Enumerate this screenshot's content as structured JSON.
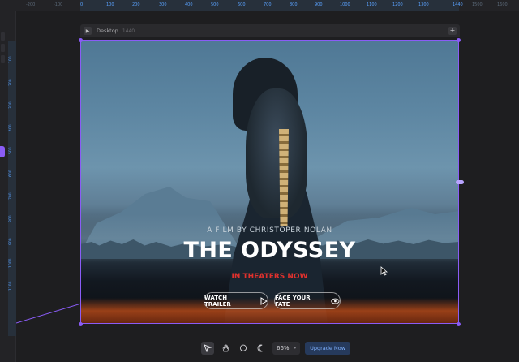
{
  "ruler": {
    "top_ticks": [
      "-200",
      "-100",
      "0",
      "100",
      "200",
      "300",
      "400",
      "500",
      "600",
      "700",
      "800",
      "900",
      "1000",
      "1100",
      "1200",
      "1300",
      "1440",
      "1500",
      "1600"
    ],
    "left_ticks": [
      "0",
      "100",
      "200",
      "300",
      "400",
      "500",
      "600",
      "700",
      "800",
      "900",
      "1000",
      "1100",
      "1200",
      "1300"
    ]
  },
  "frame": {
    "name": "Desktop",
    "width_label": "1440"
  },
  "hero": {
    "subtitle": "A FILM BY CHRISTOPER NOLAN",
    "title": "THE ODYSSEY",
    "release_note": "IN THEATERS NOW",
    "trailer_button": "WATCH TRAILER",
    "fate_button": "FACE YOUR FATE"
  },
  "toolbar": {
    "zoom_value": "66%",
    "upgrade_label": "Upgrade Now",
    "tools": [
      "cursor-tool-icon",
      "hand-tool-icon",
      "comment-icon",
      "moon-icon"
    ]
  },
  "colors": {
    "accent": "#8a5cf6",
    "release_red": "#e0312d",
    "upgrade_blue": "#7fb1ff"
  }
}
